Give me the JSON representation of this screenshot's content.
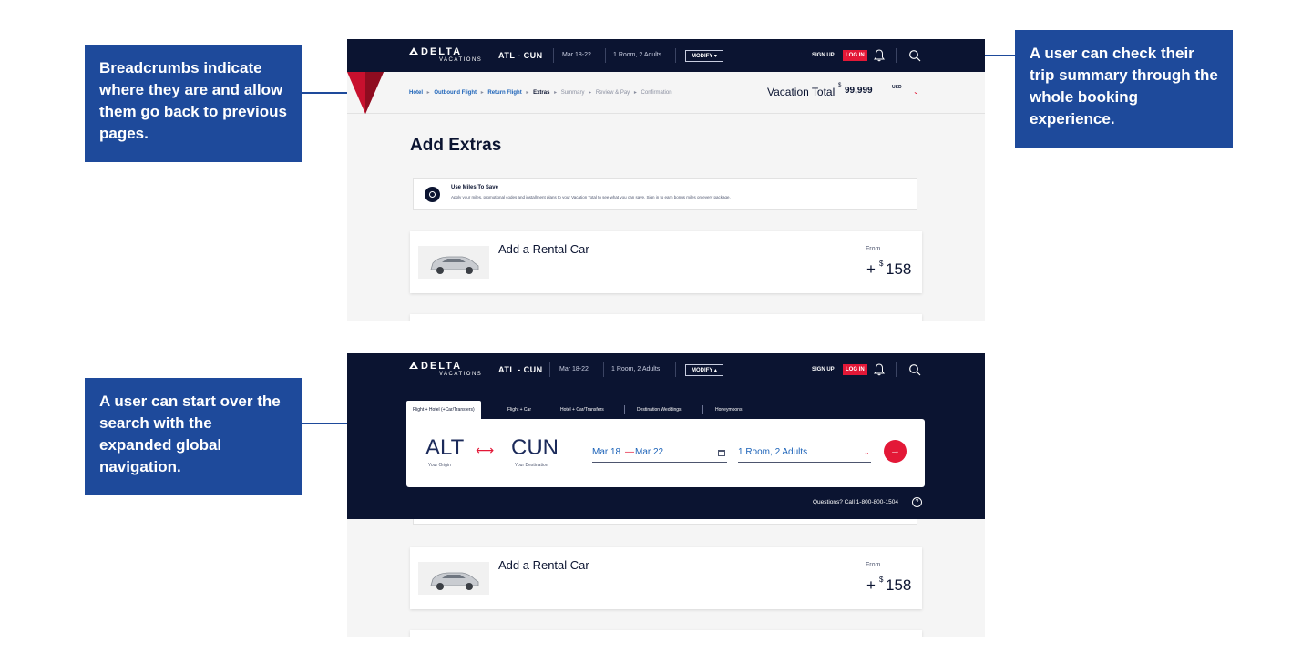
{
  "callouts": {
    "breadcrumbs": "Breadcrumbs indicate where they are and allow them go back to previous pages.",
    "summary": "A user can check their trip summary through the whole booking experience.",
    "start_over": "A user can start over the search with the expanded global navigation."
  },
  "navbar": {
    "brand": "DELTA",
    "brand_sub": "VACATIONS",
    "route": "ATL - CUN",
    "dates": "Mar 18-22",
    "guests": "1 Room, 2 Adults",
    "modify_collapsed": "MODIFY ▾",
    "modify_expanded": "MODIFY ▴",
    "signup": "SIGN UP",
    "login": "LOG IN",
    "icons": [
      "bell-icon",
      "search-icon"
    ]
  },
  "breadcrumbs": {
    "items": [
      {
        "label": "Hotel",
        "state": "link"
      },
      {
        "label": "Outbound Flight",
        "state": "link"
      },
      {
        "label": "Return Flight",
        "state": "link"
      },
      {
        "label": "Extras",
        "state": "current"
      },
      {
        "label": "Summary",
        "state": "future"
      },
      {
        "label": "Review & Pay",
        "state": "future"
      },
      {
        "label": "Confirmation",
        "state": "future"
      }
    ],
    "separator": "▸"
  },
  "vacation_total": {
    "label": "Vacation Total",
    "currency_symbol": "$",
    "amount": "99,999",
    "currency": "USD",
    "chevron": "⌄"
  },
  "page": {
    "title": "Add Extras"
  },
  "miles": {
    "title": "Use Miles To Save",
    "body": "Apply your miles, promotional codes and installment plans to your Vacation Total to see what you can save. Sign in to earn bonus miles on every package."
  },
  "rental_car": {
    "title": "Add a Rental Car",
    "from_label": "From",
    "plus": "+",
    "currency_symbol": "$",
    "price": "158"
  },
  "search": {
    "tabs": [
      "Flight + Hotel (+Car/Transfers)",
      "Flight + Car",
      "Hotel + Car/Transfers",
      "Destination Weddings",
      "Honeymoons"
    ],
    "origin_code": "ALT",
    "origin_label": "Your Origin",
    "swap": "⟷",
    "dest_code": "CUN",
    "dest_label": "Your Destination",
    "date_start": "Mar 18",
    "date_dash": "—",
    "date_end": "Mar 22",
    "guests": "1 Room, 2 Adults",
    "guests_chevron": "⌄",
    "go": "→",
    "questions": "Questions? Call 1-800-800-1504",
    "help": "?"
  },
  "colors": {
    "callout": "#1e4a9b",
    "navy": "#0b1431",
    "accent_red": "#e31837",
    "link_blue": "#1b62b8"
  }
}
